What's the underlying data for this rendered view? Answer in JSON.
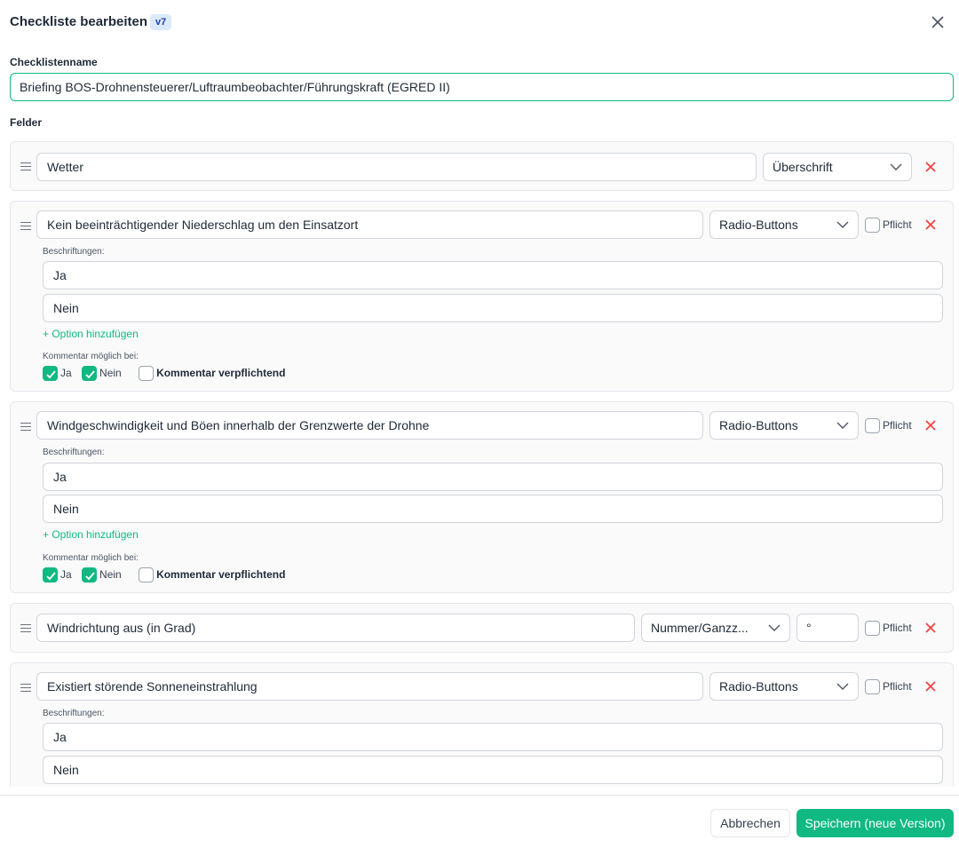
{
  "dialog": {
    "title": "Checkliste bearbeiten",
    "version": "v7",
    "name_label": "Checklistenname",
    "name_value": "Briefing BOS-Drohnensteuerer/Luftraumbeobachter/Führungskraft (EGRED II)",
    "fields_label": "Felder"
  },
  "labels": {
    "required": "Pflicht",
    "captions": "Beschriftungen:",
    "add_option": "+ Option hinzufügen",
    "comment_possible": "Kommentar möglich bei:",
    "comment_required": "Kommentar verpflichtend"
  },
  "fields": [
    {
      "label": "Wetter",
      "type": "Überschrift"
    },
    {
      "label": "Kein beeinträchtigender Niederschlag um den Einsatzort",
      "type": "Radio-Buttons",
      "required": false,
      "options": [
        "Ja",
        "Nein"
      ],
      "comment_on": [
        {
          "label": "Ja",
          "checked": true
        },
        {
          "label": "Nein",
          "checked": true
        }
      ],
      "comment_required": false
    },
    {
      "label": "Windgeschwindigkeit und Böen innerhalb der Grenzwerte der Drohne",
      "type": "Radio-Buttons",
      "required": false,
      "options": [
        "Ja",
        "Nein"
      ],
      "comment_on": [
        {
          "label": "Ja",
          "checked": true
        },
        {
          "label": "Nein",
          "checked": true
        }
      ],
      "comment_required": false
    },
    {
      "label": "Windrichtung aus (in Grad)",
      "type": "Nummer/Ganzz...",
      "unit": "°",
      "required": false
    },
    {
      "label": "Existiert störende Sonneneinstrahlung",
      "type": "Radio-Buttons",
      "required": false,
      "options": [
        "Ja",
        "Nein"
      ]
    }
  ],
  "footer": {
    "cancel": "Abbrechen",
    "save": "Speichern (neue Version)"
  },
  "colors": {
    "accent": "#10b981",
    "danger": "#ef4444",
    "badge_bg": "#dbeafe"
  }
}
